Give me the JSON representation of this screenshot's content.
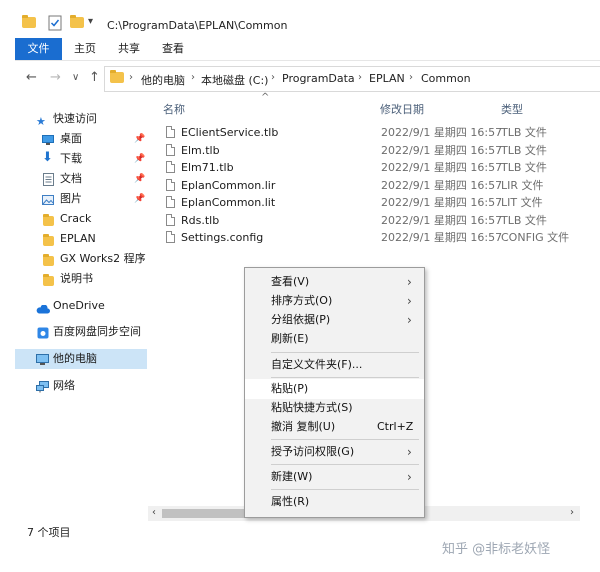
{
  "window": {
    "path": "C:\\ProgramData\\EPLAN\\Common"
  },
  "ribbon": {
    "tabs": [
      "文件",
      "主页",
      "共享",
      "查看"
    ]
  },
  "nav": {
    "back": "←",
    "forward": "→",
    "recent": "∨",
    "up": "↑"
  },
  "breadcrumb": [
    "他的电脑",
    "本地磁盘 (C:)",
    "ProgramData",
    "EPLAN",
    "Common"
  ],
  "sidebar": {
    "items": [
      {
        "label": "快速访问",
        "icon": "star-icon"
      },
      {
        "label": "桌面",
        "icon": "desktop-icon",
        "pinned": true
      },
      {
        "label": "下载",
        "icon": "download-icon",
        "pinned": true
      },
      {
        "label": "文档",
        "icon": "document-icon",
        "pinned": true
      },
      {
        "label": "图片",
        "icon": "picture-icon",
        "pinned": true
      },
      {
        "label": "Crack",
        "icon": "folder-icon"
      },
      {
        "label": "EPLAN",
        "icon": "folder-icon"
      },
      {
        "label": "GX Works2 程序",
        "icon": "folder-icon"
      },
      {
        "label": "说明书",
        "icon": "folder-icon"
      },
      {
        "label": "OneDrive",
        "icon": "cloud-icon"
      },
      {
        "label": "百度网盘同步空间",
        "icon": "baidu-cloud-icon"
      },
      {
        "label": "他的电脑",
        "icon": "computer-icon",
        "selected": true
      },
      {
        "label": "网络",
        "icon": "network-icon"
      }
    ]
  },
  "columns": {
    "name": "名称",
    "date": "修改日期",
    "type": "类型"
  },
  "files": [
    {
      "name": "EClientService.tlb",
      "date": "2022/9/1 星期四 16:57",
      "type": "TLB 文件"
    },
    {
      "name": "Elm.tlb",
      "date": "2022/9/1 星期四 16:57",
      "type": "TLB 文件"
    },
    {
      "name": "Elm71.tlb",
      "date": "2022/9/1 星期四 16:57",
      "type": "TLB 文件"
    },
    {
      "name": "EplanCommon.lir",
      "date": "2022/9/1 星期四 16:57",
      "type": "LIR 文件"
    },
    {
      "name": "EplanCommon.lit",
      "date": "2022/9/1 星期四 16:57",
      "type": "LIT 文件"
    },
    {
      "name": "Rds.tlb",
      "date": "2022/9/1 星期四 16:57",
      "type": "TLB 文件"
    },
    {
      "name": "Settings.config",
      "date": "2022/9/1 星期四 16:57",
      "type": "CONFIG 文件"
    }
  ],
  "status": "7 个项目",
  "context_menu": {
    "view": "查看(V)",
    "sort": "排序方式(O)",
    "group": "分组依据(P)",
    "refresh": "刷新(E)",
    "customize": "自定义文件夹(F)...",
    "paste": "粘贴(P)",
    "paste_shortcut": "粘贴快捷方式(S)",
    "undo": "撤消 复制(U)",
    "undo_shortcut": "Ctrl+Z",
    "access": "授予访问权限(G)",
    "new": "新建(W)",
    "properties": "属性(R)"
  },
  "watermark": "知乎 @非标老妖怪",
  "colors": {
    "accent": "#1a6dd0",
    "selection": "#cce4f7",
    "folder": "#f4c24a"
  }
}
